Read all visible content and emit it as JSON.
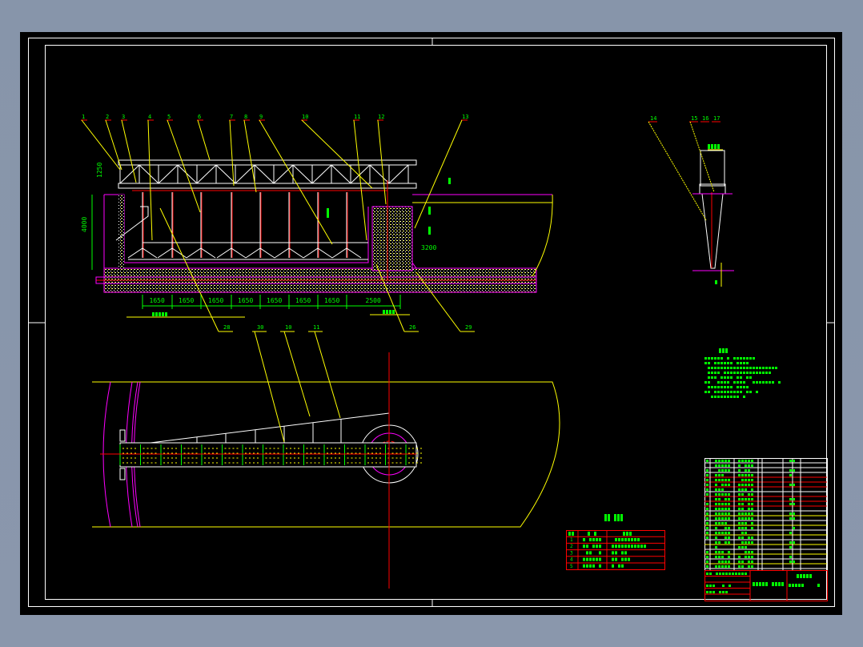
{
  "colors": {
    "background": "#8a97ac",
    "paper": "#000000",
    "frame": "#ffffff",
    "text": "#00ff00",
    "leader": "#ffff00",
    "centerline": "#ff0000",
    "concrete_outline": "#ff00ff",
    "steel": "#ffffff"
  },
  "section_view": {
    "leaders_top": [
      "1",
      "2",
      "3",
      "4",
      "5",
      "6",
      "7",
      "8",
      "9",
      "10",
      "11",
      "12",
      "13"
    ],
    "leaders_bottom": [
      "28",
      "30",
      "10",
      "11",
      "26",
      "29"
    ],
    "dimensions": {
      "bays": [
        "1650",
        "1650",
        "1650",
        "1650",
        "1650",
        "1650",
        "1650",
        "2500"
      ],
      "tank_depth": "4000",
      "truss_height": "1250",
      "right_offset": "3200"
    }
  },
  "side_view": {
    "leaders": [
      "14",
      "15",
      "16",
      "17"
    ]
  },
  "tech_table": {
    "title_icon": "chinese-title-text",
    "rows": [
      "1",
      "2",
      "3",
      "4",
      "5"
    ]
  }
}
